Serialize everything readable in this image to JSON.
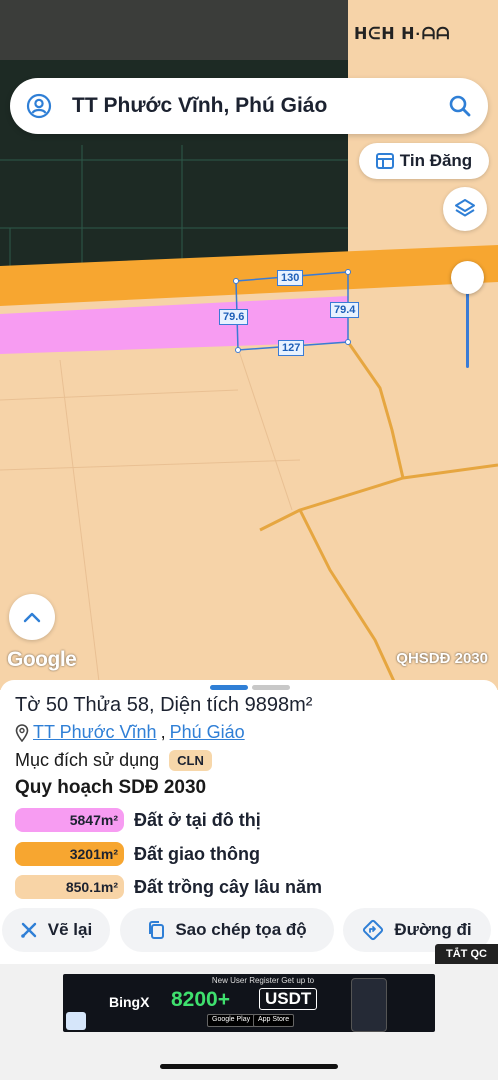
{
  "search": {
    "title": "TT Phước Vĩnh, Phú Giáo"
  },
  "map": {
    "satellite_label": "ᕼᕮᕼ ᕼ·ᗩᗩ",
    "listing_button_label": "Tin Đăng",
    "zoom_level": 0.15,
    "provider_logo": "Google",
    "layer_name": "QHSDĐ 2030",
    "dimensions": {
      "top": "130",
      "left": "79.6",
      "right": "79.4",
      "bottom": "127"
    }
  },
  "sheet": {
    "plot_title": "Tờ 50 Thửa 58, Diện tích 9898m²",
    "location": {
      "town": "TT Phước Vĩnh",
      "separator": ", ",
      "district": "Phú Giáo"
    },
    "land_use_label": "Mục đích sử dụng",
    "land_use_code": "CLN",
    "plan_title": "Quy hoạch SDĐ 2030",
    "zones": [
      {
        "area": "5847m²",
        "label": "Đất ở tại đô thị",
        "color": "#f79cf2"
      },
      {
        "area": "3201m²",
        "label": "Đất giao thông",
        "color": "#f7a630"
      },
      {
        "area": "850.1m²",
        "label": "Đất trồng cây lâu năm",
        "color": "#f8d4a6"
      }
    ],
    "actions": [
      {
        "label": "Vẽ lại",
        "icon": "erase-icon"
      },
      {
        "label": "Sao chép tọa độ",
        "icon": "copy-icon"
      },
      {
        "label": "Đường đi",
        "icon": "directions-icon"
      }
    ],
    "close_ads_label": "TẮT QC"
  },
  "ad": {
    "brand": "BingX",
    "promo": "New User Register Get up to",
    "amount": "8200+",
    "currency": "USDT",
    "store1": "Google Play",
    "store2": "App Store"
  },
  "colors": {
    "accent": "#2f7fd6",
    "road": "#f7a630",
    "residential": "#f79cf2",
    "perennial": "#f6d3a8"
  }
}
